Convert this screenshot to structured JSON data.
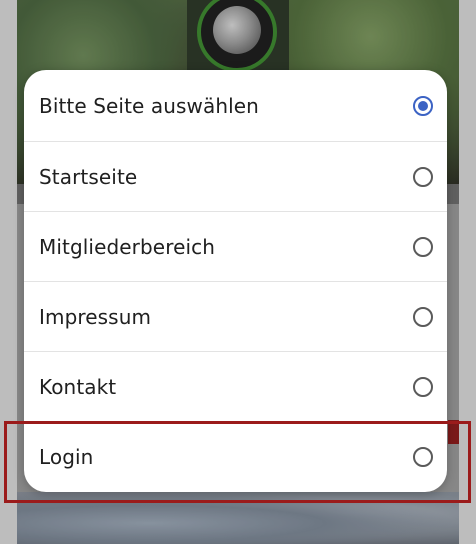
{
  "colors": {
    "accent": "#3c63c4",
    "highlight": "#9b1b1b",
    "emblem_ring": "#3f8a32"
  },
  "dialog": {
    "options": [
      {
        "label": "Bitte Seite auswählen",
        "selected": true
      },
      {
        "label": "Startseite",
        "selected": false
      },
      {
        "label": "Mitgliederbereich",
        "selected": false
      },
      {
        "label": "Impressum",
        "selected": false
      },
      {
        "label": "Kontakt",
        "selected": false
      },
      {
        "label": "Login",
        "selected": false
      }
    ]
  }
}
